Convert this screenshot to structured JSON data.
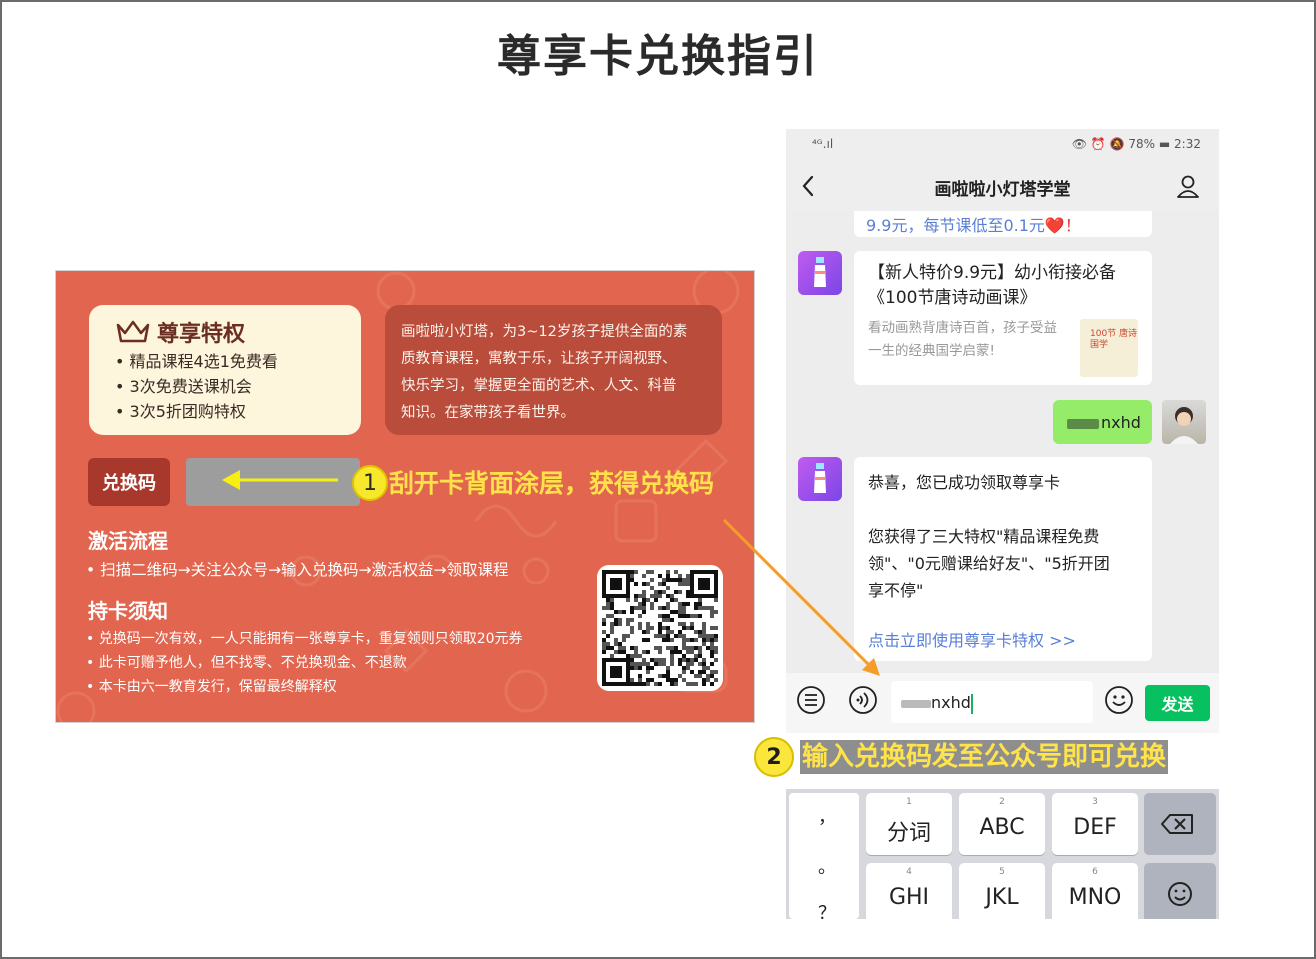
{
  "page": {
    "title": "尊享卡兑换指引"
  },
  "card": {
    "privilege_title": "尊享特权",
    "privileges": [
      "精品课程4选1免费看",
      "3次免费送课机会",
      "3次5折团购特权"
    ],
    "intro_lines": [
      "画啦啦小灯塔，为3~12岁孩子提供全面的素",
      "质教育课程，寓教于乐，让孩子开阔视野、",
      "快乐学习，掌握更全面的艺术、人文、科普",
      "知识。在家带孩子看世界。"
    ],
    "code_label": "兑换码",
    "activate_title": "激活流程",
    "activate_steps": "扫描二维码→关注公众号→输入兑换码→激活权益→领取课程",
    "notice_title": "持卡须知",
    "notices": [
      "兑换码一次有效，一人只能拥有一张尊享卡，重复领则只领取20元券",
      "此卡可赠予他人，但不找零、不兑换现金、不退款",
      "本卡由六一教育发行，保留最终解释权"
    ],
    "bg_color": "#e2664f"
  },
  "annotations": {
    "step1_num": "1",
    "step1_text": "刮开卡背面涂层，获得兑换码",
    "step2_num": "2",
    "step2_text": "输入兑换码发至公众号即可兑换"
  },
  "phone": {
    "status_signal": "⁴ᴳ.ıl",
    "status_right": "👁 ⏰ 🔕 78% ▬ 2:32",
    "chat_title": "画啦啦小灯塔学堂",
    "msg_top_text": "9.9元，每节课低至0.1元",
    "msg_top_suffix": "❤️！",
    "course_title_lines": [
      "【新人特价9.9元】幼小衔接必备",
      "《100节唐诗动画课》"
    ],
    "course_desc": "看动画熟背唐诗百首，孩子受益一生的经典国学启蒙!",
    "course_thumb_text": "100节 唐诗国学",
    "my_message_visible": "nxhd",
    "congrats_lines": [
      "恭喜，您已成功领取尊享卡",
      "",
      "您获得了三大特权\"精品课程免费",
      "领\"、\"0元赠课给好友\"、\"5折开团",
      "享不停\""
    ],
    "congrats_link": "点击立即使用尊享卡特权 >>",
    "input_value_visible": "nxhd",
    "send_label": "发送",
    "accent": "#07c160"
  },
  "keyboard": {
    "punct": [
      "，",
      "。",
      "？"
    ],
    "keys": [
      {
        "num": "1",
        "label": "分词"
      },
      {
        "num": "2",
        "label": "ABC"
      },
      {
        "num": "3",
        "label": "DEF"
      },
      {
        "num": "4",
        "label": "GHI"
      },
      {
        "num": "5",
        "label": "JKL"
      },
      {
        "num": "6",
        "label": "MNO"
      }
    ]
  }
}
